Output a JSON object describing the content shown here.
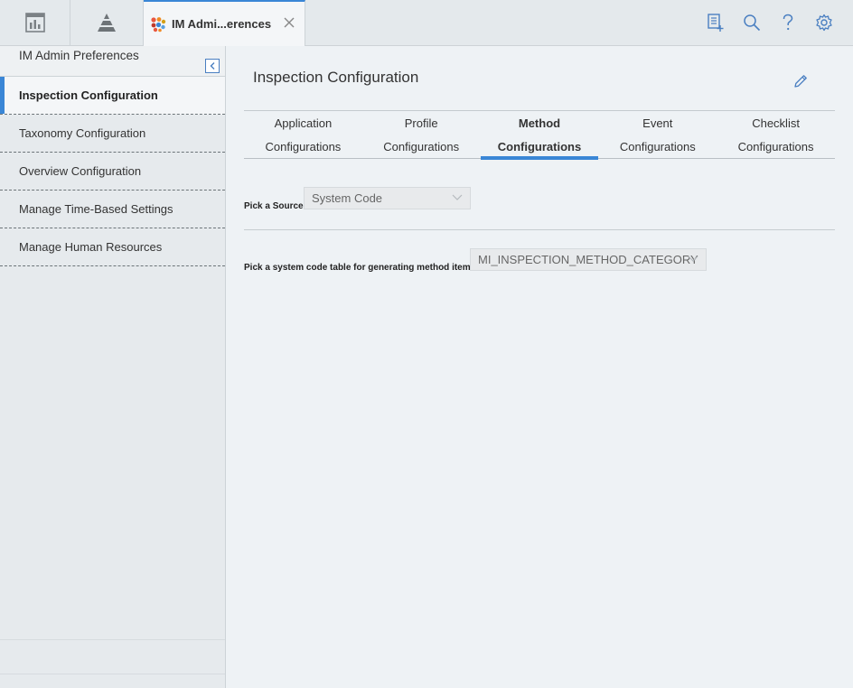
{
  "topbar": {
    "app_tabs": [
      {
        "icon": "dashboard-icon"
      },
      {
        "icon": "pyramid-icon"
      }
    ],
    "doc_tab": {
      "icon": "im-admin-icon",
      "label": "IM Admi...erences",
      "close_icon": "close-icon"
    },
    "tools": [
      {
        "icon": "new-document-icon"
      },
      {
        "icon": "search-icon"
      },
      {
        "icon": "help-icon"
      },
      {
        "icon": "gear-icon"
      }
    ]
  },
  "sidebar": {
    "title": "IM Admin Preferences",
    "items": [
      {
        "label": "Inspection Configuration",
        "active": true
      },
      {
        "label": "Taxonomy Configuration",
        "active": false
      },
      {
        "label": "Overview Configuration",
        "active": false
      },
      {
        "label": "Manage Time-Based Settings",
        "active": false
      },
      {
        "label": "Manage Human Resources",
        "active": false
      }
    ]
  },
  "main": {
    "title": "Inspection Configuration",
    "tabs": [
      {
        "line1": "Application",
        "line2": "Configurations",
        "active": false
      },
      {
        "line1": "Profile",
        "line2": "Configurations",
        "active": false
      },
      {
        "line1": "Method",
        "line2": "Configurations",
        "active": true
      },
      {
        "line1": "Event",
        "line2": "Configurations",
        "active": false
      },
      {
        "line1": "Checklist",
        "line2": "Configurations",
        "active": false
      }
    ],
    "source": {
      "label": "Pick a Source:",
      "value": "System Code"
    },
    "system_code": {
      "label": "Pick a system code table for generating method items:",
      "value": "MI_INSPECTION_METHOD_CATEGORY"
    }
  },
  "colors": {
    "accent": "#3a86d6",
    "sidebar_bg": "#e6eaed",
    "main_bg": "#eef2f5"
  }
}
